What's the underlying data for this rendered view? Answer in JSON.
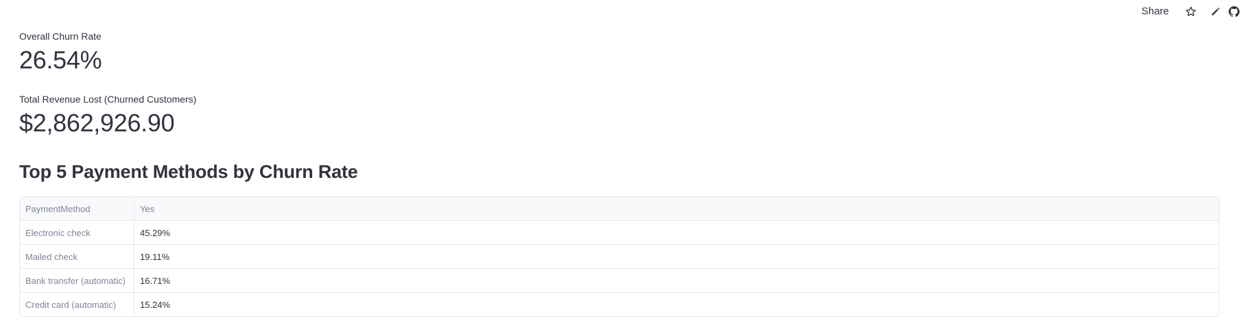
{
  "toolbar": {
    "share_label": "Share",
    "icons": [
      "star-icon",
      "pencil-icon",
      "github-icon"
    ]
  },
  "metrics": {
    "churn_rate": {
      "label": "Overall Churn Rate",
      "value": "26.54%"
    },
    "revenue_lost": {
      "label": "Total Revenue Lost (Churned Customers)",
      "value": "$2,862,926.90"
    }
  },
  "section": {
    "title": "Top 5 Payment Methods by Churn Rate"
  },
  "table": {
    "headers": [
      "PaymentMethod",
      "Yes"
    ],
    "rows": [
      {
        "method": "Electronic check",
        "yes": "45.29%"
      },
      {
        "method": "Mailed check",
        "yes": "19.11%"
      },
      {
        "method": "Bank transfer (automatic)",
        "yes": "16.71%"
      },
      {
        "method": "Credit card (automatic)",
        "yes": "15.24%"
      }
    ]
  },
  "colors": {
    "text": "#31333f",
    "muted": "#808495",
    "border": "#e6e9ef",
    "header_bg": "#f8f9fb"
  }
}
